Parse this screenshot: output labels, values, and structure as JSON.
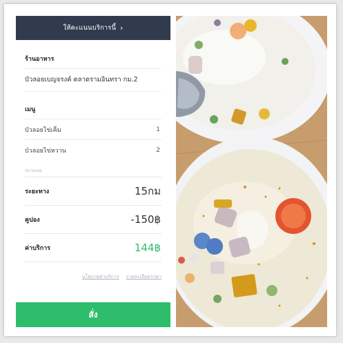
{
  "header": {
    "title": "ให้คะแนนบริการนี้",
    "chevron_icon": "chevron-right-icon"
  },
  "restaurant": {
    "section_label": "ร้านอาหาร",
    "name": "บัวลอยเบญจรงค์ ตลาดรามอินทรา กม.2"
  },
  "menu": {
    "section_label": "เมนู",
    "items": [
      {
        "name": "บัวลอยไข่เค็ม",
        "qty": "1"
      },
      {
        "name": "บัวลอยไข่หวาน",
        "qty": "2"
      }
    ]
  },
  "faded_text": "หมายเหตุ",
  "summary": {
    "distance": {
      "label": "ระยะทาง",
      "value": "15กม"
    },
    "coupon": {
      "label": "คูปอง",
      "value": "-150฿"
    },
    "fee": {
      "label": "ค่าบริการ",
      "value": "144฿"
    }
  },
  "links": {
    "pricing_policy": "นโยบายค่าบริการ",
    "price_details": "รายละเอียดราคา"
  },
  "order_button": {
    "label": "สั่ง"
  },
  "photo": {
    "icon": "food-photo",
    "subject": "บัวลอยไข่หวาน"
  },
  "colors": {
    "header_bg": "#323a4d",
    "accent_green": "#2ebd6b",
    "link_gray": "#a8b0bd"
  }
}
